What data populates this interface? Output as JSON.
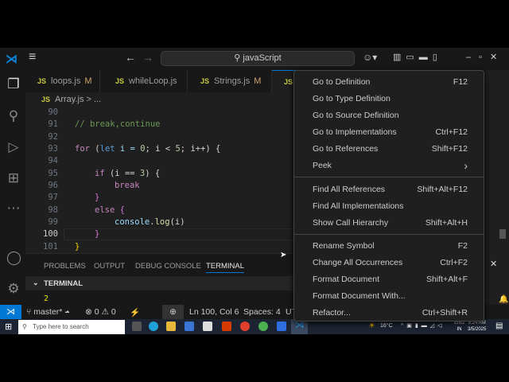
{
  "titlebar": {
    "search": "javaScript"
  },
  "tabs": [
    {
      "label": "loops.js",
      "badge": "M"
    },
    {
      "label": "whileLoop.js",
      "badge": ""
    },
    {
      "label": "Strings.js",
      "badge": "M"
    },
    {
      "label": "",
      "badge": ""
    }
  ],
  "js_icon": "JS",
  "breadcrumb": {
    "file": "Array.js",
    "rest": "> ..."
  },
  "line_numbers": [
    "90",
    "91",
    "92",
    "93",
    "94",
    "95",
    "96",
    "97",
    "98",
    "99",
    "100",
    "101"
  ],
  "code": {
    "l91": "// break,continue",
    "l93a": "for",
    "l93b": " (",
    "l93c": "let",
    "l93d": " i = ",
    "l93e": "0",
    "l93f": "; i < ",
    "l93g": "5",
    "l93h": "; i++) {",
    "l95a": "if",
    "l95b": " (i == ",
    "l95c": "3",
    "l95d": ") {",
    "l96": "break",
    "l97": "}",
    "l98a": "else",
    "l98b": " {",
    "l99a": "console",
    "l99b": ".",
    "l99c": "log",
    "l99d": "(i)",
    "l100": "}",
    "l101": "}"
  },
  "panel": {
    "tabs": [
      "PROBLEMS",
      "OUTPUT",
      "DEBUG CONSOLE",
      "TERMINAL"
    ],
    "terminal_header": "TERMINAL",
    "output": "2"
  },
  "status": {
    "branch": "master*",
    "errors": "0",
    "warnings": "0",
    "position": "Ln 100, Col 6",
    "spaces": "Spaces: 4",
    "enc": "UT"
  },
  "taskbar": {
    "search": "Type here to search",
    "weather": "16°C",
    "lang1": "ENG",
    "lang2": "IN",
    "time": "9:24 AM",
    "date": "3/5/2025"
  },
  "menu": [
    [
      {
        "label": "Go to Definition",
        "key": "F12"
      },
      {
        "label": "Go to Type Definition",
        "key": ""
      },
      {
        "label": "Go to Source Definition",
        "key": ""
      },
      {
        "label": "Go to Implementations",
        "key": "Ctrl+F12"
      },
      {
        "label": "Go to References",
        "key": "Shift+F12"
      },
      {
        "label": "Peek",
        "key": "›"
      }
    ],
    [
      {
        "label": "Find All References",
        "key": "Shift+Alt+F12"
      },
      {
        "label": "Find All Implementations",
        "key": ""
      },
      {
        "label": "Show Call Hierarchy",
        "key": "Shift+Alt+H"
      }
    ],
    [
      {
        "label": "Rename Symbol",
        "key": "F2"
      },
      {
        "label": "Change All Occurrences",
        "key": "Ctrl+F2"
      },
      {
        "label": "Format Document",
        "key": "Shift+Alt+F"
      },
      {
        "label": "Format Document With...",
        "key": ""
      },
      {
        "label": "Refactor...",
        "key": "Ctrl+Shift+R"
      }
    ]
  ]
}
